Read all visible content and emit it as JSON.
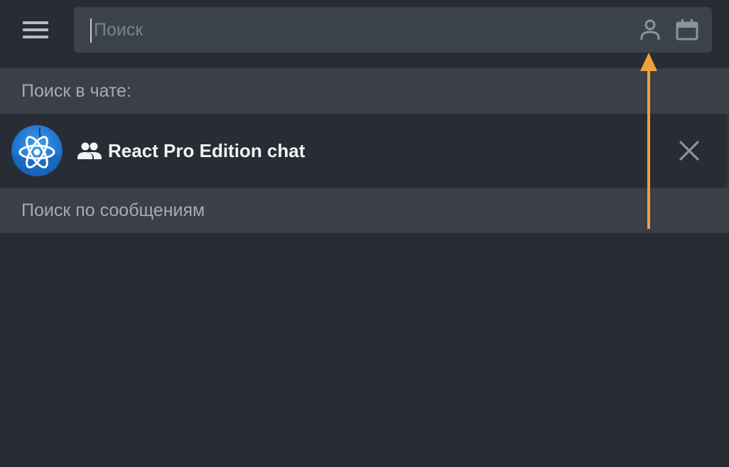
{
  "search": {
    "placeholder": "Поиск",
    "value": ""
  },
  "icons": {
    "menu": "hamburger-icon",
    "person": "person-icon",
    "calendar": "calendar-icon",
    "group": "group-icon",
    "close": "close-icon",
    "avatar": "react-atom-icon"
  },
  "sections": {
    "chat_search_label": "Поиск в чате:",
    "message_search_label": "Поиск по сообщениям"
  },
  "chat": {
    "title": "React Pro Edition chat"
  },
  "colors": {
    "background": "#282c34",
    "search_bg": "#3c424c",
    "section_bg": "#3a3f48",
    "annotation_arrow": "#f0a03c",
    "avatar_blue": "#1e7ad6"
  }
}
